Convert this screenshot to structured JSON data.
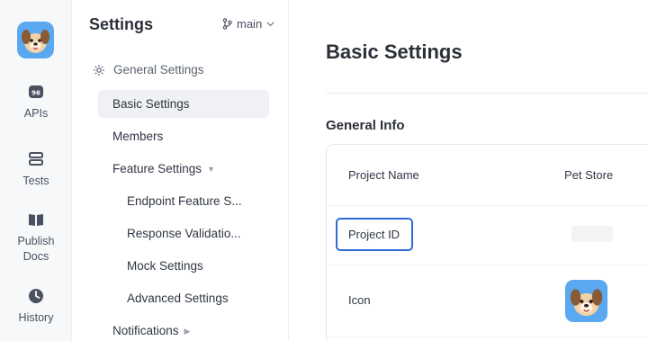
{
  "rail": {
    "items": [
      {
        "label": "APIs",
        "icon": "api-icon"
      },
      {
        "label": "Tests",
        "icon": "tests-icon"
      },
      {
        "label": "Publish Docs",
        "icon": "docs-icon"
      },
      {
        "label": "History",
        "icon": "history-icon"
      }
    ]
  },
  "nav": {
    "title": "Settings",
    "branch": "main",
    "group_label": "General Settings",
    "items": [
      {
        "label": "Basic Settings"
      },
      {
        "label": "Members"
      },
      {
        "label": "Feature Settings"
      },
      {
        "label": "Endpoint Feature S..."
      },
      {
        "label": "Response Validatio..."
      },
      {
        "label": "Mock Settings"
      },
      {
        "label": "Advanced Settings"
      },
      {
        "label": "Notifications"
      }
    ]
  },
  "main": {
    "title": "Basic Settings",
    "section": "General Info",
    "rows": [
      {
        "key": "Project Name",
        "value": "Pet Store"
      },
      {
        "key": "Project ID",
        "value": ""
      },
      {
        "key": "Icon",
        "value": ""
      }
    ]
  },
  "colors": {
    "accent": "#2f6bd8",
    "rail_bg": "#f7f8fa",
    "active_item_bg": "#f0f1f4"
  }
}
